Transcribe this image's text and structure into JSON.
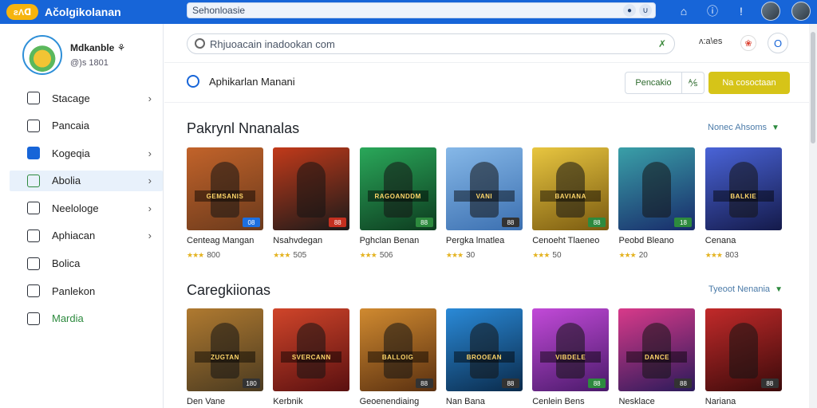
{
  "topbar": {
    "logo_text": "ƨɅᗡ",
    "app_title": "Ačolgikolanan",
    "search_value": "Sehonloasie",
    "icons": [
      "mic-icon",
      "filter-icon",
      "home-icon",
      "info-icon",
      "notification-icon",
      "user-icon"
    ]
  },
  "sidebar": {
    "profile_name": "Mdkanble ⚘",
    "profile_sub": "@)s 1801",
    "items": [
      {
        "label": "Stacage",
        "icon": "card-icon",
        "chevron": true,
        "active": false
      },
      {
        "label": "Pancaia",
        "icon": "document-icon",
        "chevron": false,
        "active": false
      },
      {
        "label": "Kogeqia",
        "icon": "bag-icon",
        "chevron": true,
        "active": false
      },
      {
        "label": "Abolia",
        "icon": "store-icon",
        "chevron": true,
        "active": true
      },
      {
        "label": "Neelologe",
        "icon": "list-icon",
        "chevron": true,
        "active": false
      },
      {
        "label": "Aphiacan",
        "icon": "edit-icon",
        "chevron": true,
        "active": false
      },
      {
        "label": "Bolica",
        "icon": "grid-icon",
        "chevron": false,
        "active": false
      },
      {
        "label": "Panlekon",
        "icon": "tablet-icon",
        "chevron": false,
        "active": false
      },
      {
        "label": "Mardia",
        "icon": "table-icon",
        "chevron": false,
        "active": false
      }
    ]
  },
  "main": {
    "search_placeholder": "Rhjuoacain inadookan com",
    "search_suffix": "✗",
    "header_extra": "ʌ:a\\es",
    "page_title": "Aphikarlan Manani",
    "btn_outline": "Pencakio",
    "btn_icon": "⅍",
    "btn_primary": "Na cosoctaan",
    "sections": [
      {
        "title": "Pakrynl Nnanalas",
        "link": "Nonec Ahsoms",
        "cards": [
          {
            "name": "Centeag Mangan",
            "rating": "800",
            "tag": "08",
            "banner": "GEMSANIS",
            "bg": [
              "#6b3a1c",
              "#c2632a"
            ],
            "tagColor": "#1d6fe0"
          },
          {
            "name": "Nsahvdegan",
            "rating": "505",
            "tag": "88",
            "banner": "",
            "bg": [
              "#1a1a1a",
              "#c23a1a"
            ],
            "tagColor": "#c43020"
          },
          {
            "name": "Pghclan Benan",
            "rating": "506",
            "tag": "88",
            "banner": "RAGOANDDM",
            "bg": [
              "#0d3b1f",
              "#2aa85a"
            ],
            "tagColor": "#2d8a3e"
          },
          {
            "name": "Pergka lmatlea",
            "rating": "30",
            "tag": "88",
            "banner": "VANI",
            "bg": [
              "#3b6fb0",
              "#86b8e8"
            ],
            "tagColor": "#333"
          },
          {
            "name": "Cenoeht Tlaeneo",
            "rating": "50",
            "tag": "88",
            "banner": "BAVIANA",
            "bg": [
              "#7a5a10",
              "#e8c640"
            ],
            "tagColor": "#2d8a3e"
          },
          {
            "name": "Peobd Bleano",
            "rating": "20",
            "tag": "18",
            "banner": "",
            "bg": [
              "#182a6a",
              "#3aa0a8"
            ],
            "tagColor": "#2d8a3e"
          },
          {
            "name": "Cenana",
            "rating": "803",
            "tag": "",
            "banner": "BALKIE",
            "bg": [
              "#141a4a",
              "#4a64d8"
            ],
            "tagColor": "#1d6fe0"
          }
        ]
      },
      {
        "title": "Caregkiionas",
        "link": "Tyeoot Nenania",
        "cards": [
          {
            "name": "Den Vane",
            "rating": "",
            "tag": "180",
            "banner": "ZUGTAN",
            "bg": [
              "#4a3a20",
              "#b07a30"
            ],
            "tagColor": "#333"
          },
          {
            "name": "Kerbnik",
            "rating": "",
            "tag": "",
            "banner": "SVERCANN",
            "bg": [
              "#5a1010",
              "#d0452a"
            ],
            "tagColor": "#333"
          },
          {
            "name": "Geoenendiaing",
            "rating": "",
            "tag": "88",
            "banner": "BALLOIG",
            "bg": [
              "#5a3010",
              "#d08a30"
            ],
            "tagColor": "#333"
          },
          {
            "name": "Nan Bana",
            "rating": "",
            "tag": "88",
            "banner": "BROOEAN",
            "bg": [
              "#0a2a4a",
              "#2a8ad8"
            ],
            "tagColor": "#333"
          },
          {
            "name": "Cenlein Bens",
            "rating": "",
            "tag": "88",
            "banner": "VIBDELE",
            "bg": [
              "#4a1a6a",
              "#c24ad8"
            ],
            "tagColor": "#2d8a3e"
          },
          {
            "name": "Nesklace",
            "rating": "",
            "tag": "88",
            "banner": "DANCE",
            "bg": [
              "#2a1a5a",
              "#d83a8a"
            ],
            "tagColor": "#333"
          },
          {
            "name": "Nariana",
            "rating": "",
            "tag": "88",
            "banner": "",
            "bg": [
              "#3a0a0a",
              "#c22a2a"
            ],
            "tagColor": "#333"
          }
        ]
      }
    ]
  }
}
